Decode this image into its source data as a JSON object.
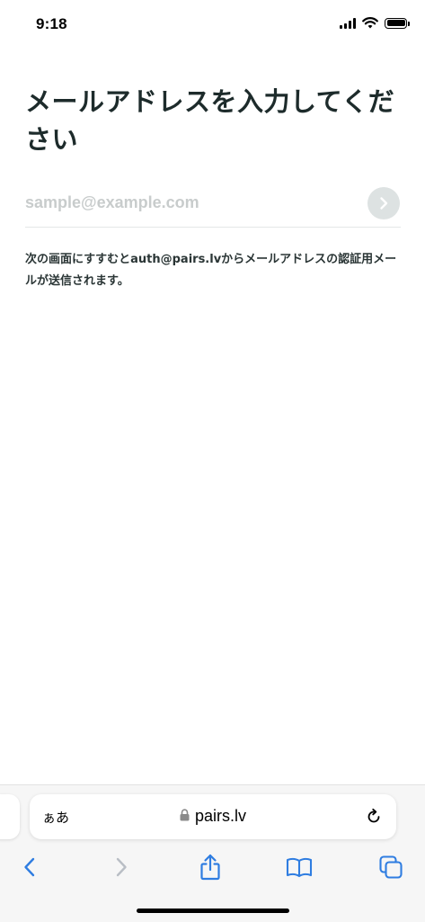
{
  "status_bar": {
    "time": "9:18"
  },
  "page": {
    "title": "メールアドレスを入力してください",
    "email_placeholder": "sample@example.com",
    "email_value": "",
    "notice": "次の画面にすすむとauth@pairs.lvからメールアドレスの認証用メールが送信されます。"
  },
  "browser": {
    "text_size_label": "ぁあ",
    "url": "pairs.lv"
  },
  "colors": {
    "title": "#1d2b2b",
    "placeholder": "#c8cccc",
    "next_button_bg": "#dde2e2",
    "toolbar_accent": "#2f7de1",
    "toolbar_disabled": "#b9bec5"
  },
  "icons": [
    "signal-icon",
    "wifi-icon",
    "battery-icon",
    "chevron-right-icon",
    "lock-icon",
    "reload-icon",
    "back-icon",
    "forward-icon",
    "share-icon",
    "bookmarks-icon",
    "tabs-icon"
  ]
}
